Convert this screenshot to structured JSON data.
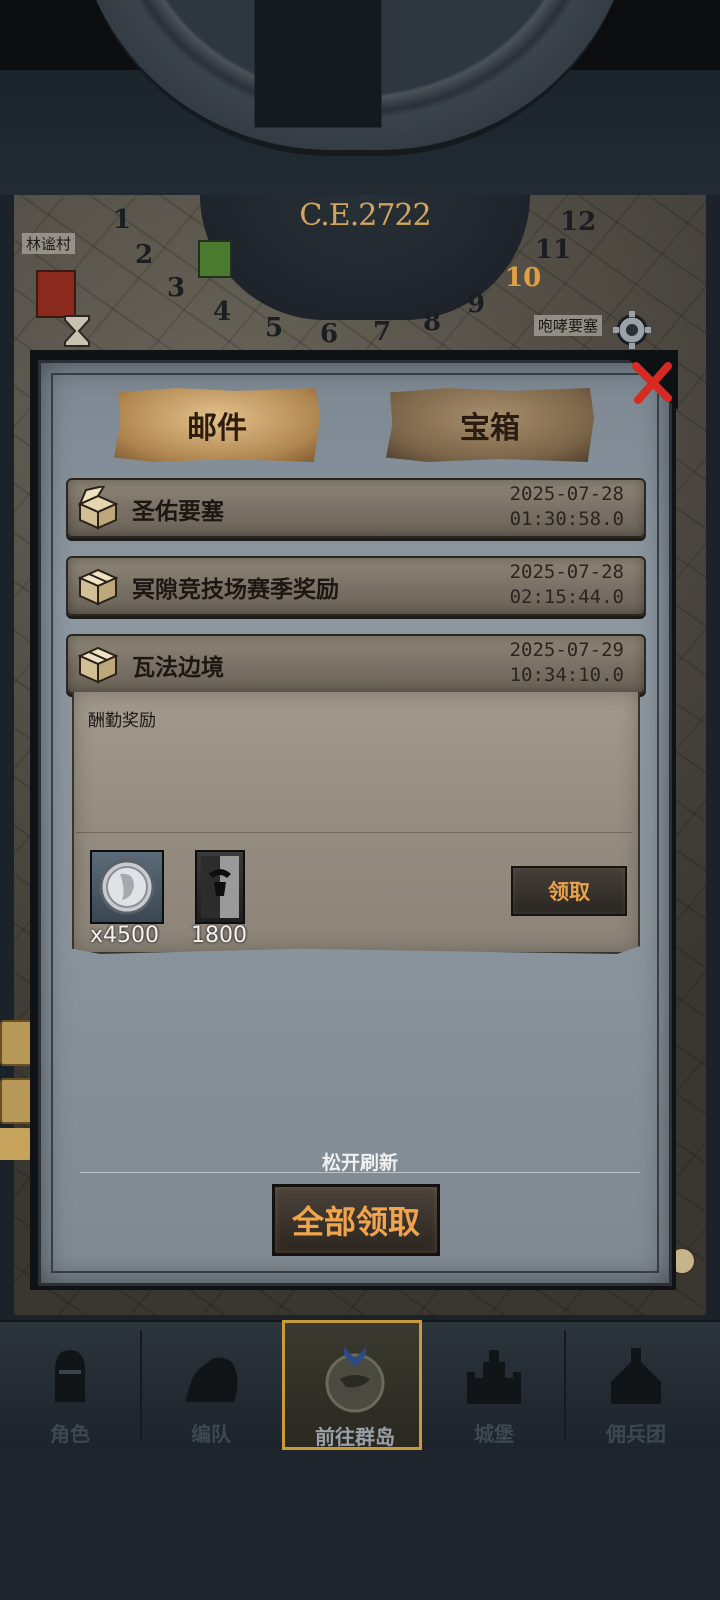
{
  "hud": {
    "year": "C.E.2722",
    "dial_numbers": [
      "1",
      "2",
      "3",
      "4",
      "5",
      "6",
      "7",
      "8",
      "9",
      "10",
      "11",
      "12"
    ],
    "highlight_number": "10",
    "map_labels": [
      "林谧村",
      "咆哮要塞"
    ]
  },
  "mail": {
    "tabs": [
      {
        "label": "邮件",
        "active": true
      },
      {
        "label": "宝箱",
        "active": false
      }
    ],
    "items": [
      {
        "title": "圣佑要塞",
        "date": "2025-07-28",
        "time": "01:30:58.0"
      },
      {
        "title": "冥隙竞技场赛季奖励",
        "date": "2025-07-28",
        "time": "02:15:44.0"
      },
      {
        "title": "瓦法边境",
        "date": "2025-07-29",
        "time": "10:34:10.0"
      }
    ],
    "detail": {
      "label": "酬勤奖励",
      "rewards": [
        {
          "icon": "silver-coin-icon",
          "amount": "x4500"
        },
        {
          "icon": "war-banner-icon",
          "amount": "1800"
        }
      ],
      "claim_label": "领取"
    },
    "refresh_hint": "松开刷新",
    "claim_all_label": "全部领取"
  },
  "nav": {
    "items": [
      {
        "label": "角色",
        "icon": "knight-helmet-icon",
        "active": false
      },
      {
        "label": "编队",
        "icon": "squad-icon",
        "active": false
      },
      {
        "label": "前往群岛",
        "icon": "compass-icon",
        "active": true
      },
      {
        "label": "城堡",
        "icon": "castle-icon",
        "active": false
      },
      {
        "label": "佣兵团",
        "icon": "mercenary-icon",
        "active": false
      }
    ]
  },
  "colors": {
    "accent_gold": "#d4a65a",
    "button_orange": "#f2a44c",
    "close_red": "#d82a22",
    "active_nav_border": "#c79a3a"
  }
}
